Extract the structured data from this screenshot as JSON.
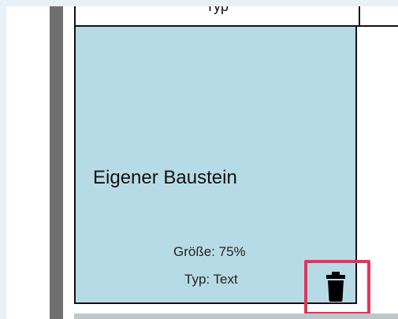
{
  "top_block": {
    "partial_text": "Typ"
  },
  "card": {
    "title": "Eigener Baustein",
    "size_label": "Größe: 75%",
    "type_label": "Typ: Text"
  },
  "colors": {
    "card_bg": "#b7dbe6",
    "highlight": "#e5335e",
    "page_bg": "#e6f2f6"
  },
  "icons": {
    "delete": "trash-icon"
  }
}
